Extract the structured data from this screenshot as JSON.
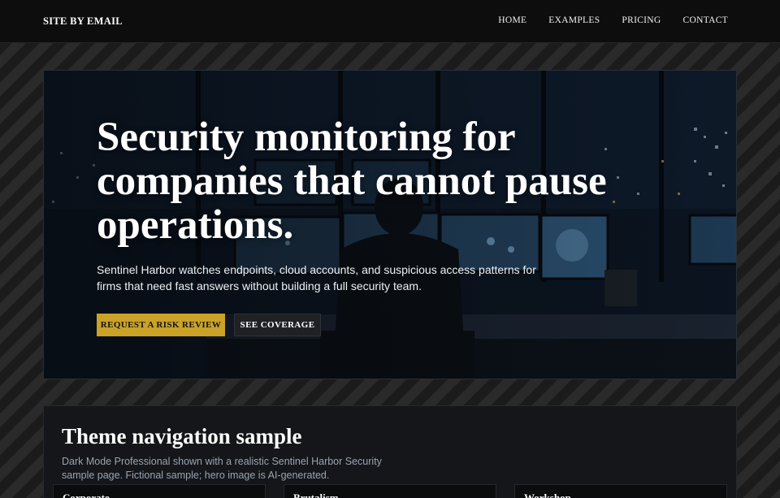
{
  "brand": "SITE BY EMAIL",
  "nav": {
    "items": [
      {
        "label": "HOME",
        "name": "nav-home"
      },
      {
        "label": "EXAMPLES",
        "name": "nav-examples"
      },
      {
        "label": "PRICING",
        "name": "nav-pricing"
      },
      {
        "label": "CONTACT",
        "name": "nav-contact"
      }
    ]
  },
  "hero": {
    "title": "Security monitoring for companies that cannot pause operations.",
    "subtitle": "Sentinel Harbor watches endpoints, cloud accounts, and suspicious access patterns for firms that need fast answers without building a full security team.",
    "primary_button": "REQUEST A RISK REVIEW",
    "secondary_button": "SEE COVERAGE"
  },
  "panel": {
    "title": "Theme navigation sample",
    "description": "Dark Mode Professional shown with a realistic Sentinel Harbor Security sample page. Fictional sample; hero image is AI-generated.",
    "cards": [
      "Corporate",
      "Brutalism",
      "Workshop"
    ]
  },
  "colors": {
    "accent": "#c9a227",
    "nav_bg": "#0d0d0e",
    "panel_bg": "#141619",
    "muted_text": "#9aa4b2"
  }
}
